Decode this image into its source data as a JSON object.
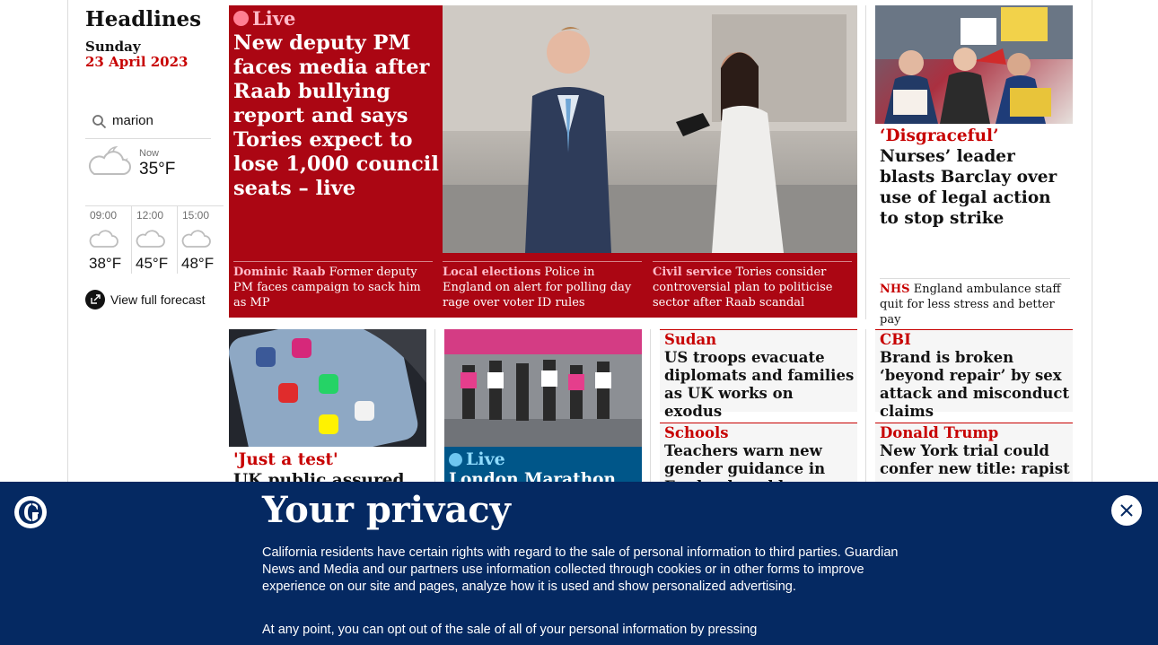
{
  "sidebar": {
    "title": "Headlines",
    "day": "Sunday",
    "date": "23 April 2023",
    "search_value": "marion",
    "now_label": "Now",
    "now_temp": "35°F",
    "forecast": [
      {
        "time": "09:00",
        "temp": "38°F"
      },
      {
        "time": "12:00",
        "temp": "45°F"
      },
      {
        "time": "15:00",
        "temp": "48°F"
      }
    ],
    "forecast_link": "View full forecast"
  },
  "lead": {
    "live": "Live",
    "headline": "New deputy PM faces media after Raab bullying report and says Tories expect to lose 1,000 council seats – live",
    "subs": [
      {
        "kicker": "Dominic Raab",
        "text": "Former deputy PM faces campaign to sack him as MP"
      },
      {
        "kicker": "Local elections",
        "text": "Police in England on alert for polling day rage over voter ID rules"
      },
      {
        "kicker": "Civil service",
        "text": "Tories consider controversial plan to politicise sector after Raab scandal"
      }
    ]
  },
  "right_top": {
    "kicker": "‘Disgraceful’",
    "headline": "Nurses’ leader blasts Barclay over use of legal action to stop strike",
    "sub_kicker": "NHS",
    "sub_text": "England ambulance staff quit for less stress and better pay"
  },
  "row2": {
    "card1": {
      "kicker": "'Just a test'",
      "headline": "UK public assured they"
    },
    "card2": {
      "live": "Live",
      "headline": "London Marathon"
    },
    "card3": {
      "kicker": "Sudan",
      "headline": "US troops evacuate diplomats and families as UK works on exodus"
    },
    "card4": {
      "kicker": "CBI",
      "headline": "Brand is broken ‘beyond repair’ by sex attack and misconduct claims"
    },
    "card5": {
      "kicker": "Schools",
      "headline": "Teachers warn new gender guidance in England could"
    },
    "card6": {
      "kicker": "Donald Trump",
      "headline": "New York trial could confer new title: rapist"
    }
  },
  "banner": {
    "title": "Your privacy",
    "text1": "California residents have certain rights with regard to the sale of personal information to third parties. Guardian News and Media and our partners use information collected through cookies or in other forms to improve experience on our site and pages, analyze how it is used and show personalized advertising.",
    "text2": "At any point, you can opt out of the sale of all of your personal information by pressing"
  },
  "colors": {
    "brand_red": "#c70000",
    "live_red": "#ab0613",
    "banner_blue": "#052962",
    "live_blue": "#0077b6"
  }
}
